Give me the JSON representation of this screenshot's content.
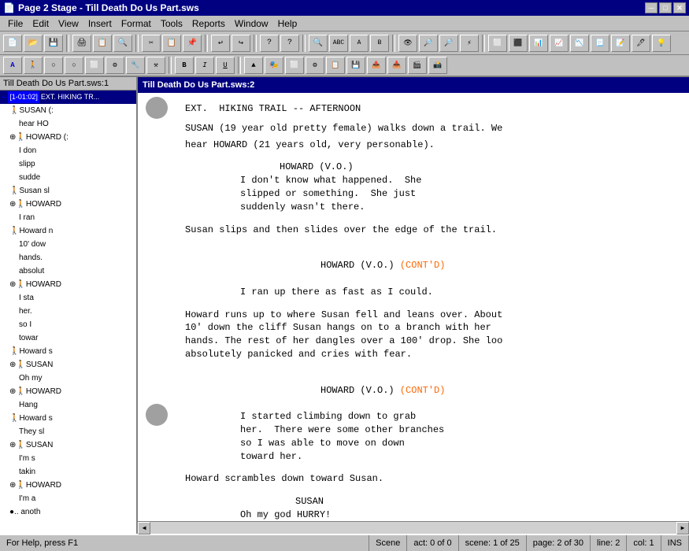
{
  "title_bar": {
    "title": "Page 2 Stage - Till Death Do Us Part.sws",
    "minimize": "─",
    "maximize": "□",
    "close": "✕"
  },
  "menu": {
    "items": [
      "File",
      "Edit",
      "View",
      "Insert",
      "Format",
      "Tools",
      "Reports",
      "Window",
      "Help"
    ]
  },
  "left_panel": {
    "header": "Till Death Do Us Part.sws:1",
    "tree_items": [
      {
        "indent": 0,
        "text": "─[1-01:02]    EXT.  HIKING TR",
        "selected": true
      },
      {
        "indent": 1,
        "text": "🚶SUSAN (:"
      },
      {
        "indent": 2,
        "text": "hear HO"
      },
      {
        "indent": 1,
        "text": "⊕🚶HOWARD (:"
      },
      {
        "indent": 2,
        "text": "I don"
      },
      {
        "indent": 2,
        "text": "slipp"
      },
      {
        "indent": 2,
        "text": "sudde"
      },
      {
        "indent": 1,
        "text": "🚶Susan sl"
      },
      {
        "indent": 1,
        "text": "⊕🚶HOWARD"
      },
      {
        "indent": 2,
        "text": "I ran"
      },
      {
        "indent": 1,
        "text": "🚶Howard r"
      },
      {
        "indent": 2,
        "text": "10' dow"
      },
      {
        "indent": 2,
        "text": "hands."
      },
      {
        "indent": 2,
        "text": "absolut"
      },
      {
        "indent": 1,
        "text": "⊕🚶HOWARD"
      },
      {
        "indent": 2,
        "text": "I sta"
      },
      {
        "indent": 2,
        "text": "her."
      },
      {
        "indent": 2,
        "text": "so I"
      },
      {
        "indent": 2,
        "text": "towar"
      },
      {
        "indent": 1,
        "text": "🚶Howard s"
      },
      {
        "indent": 1,
        "text": "⊕🚶SUSAN"
      },
      {
        "indent": 2,
        "text": "Oh my"
      },
      {
        "indent": 1,
        "text": "⊕🚶HOWARD"
      },
      {
        "indent": 2,
        "text": "Hang"
      },
      {
        "indent": 1,
        "text": "🚶Howard s"
      },
      {
        "indent": 2,
        "text": "They sl"
      },
      {
        "indent": 1,
        "text": "⊕🚶SUSAN"
      },
      {
        "indent": 2,
        "text": "I'm s"
      },
      {
        "indent": 2,
        "text": "takin"
      },
      {
        "indent": 1,
        "text": "⊕🚶HOWARD"
      },
      {
        "indent": 2,
        "text": "I'm a"
      },
      {
        "indent": 1,
        "text": "...    anoth"
      }
    ]
  },
  "right_panel": {
    "header": "Till Death Do Us Part.sws:2",
    "script": [
      {
        "type": "scene",
        "text": "EXT.  HIKING TRAIL -- AFTERNOON"
      },
      {
        "type": "blank"
      },
      {
        "type": "action",
        "text": "SUSAN (19 year old pretty female) walks down a trail. We"
      },
      {
        "type": "action",
        "text": "hear HOWARD (21 years old, very personable)."
      },
      {
        "type": "blank"
      },
      {
        "type": "character",
        "text": "HOWARD (V.O.)"
      },
      {
        "type": "dialog",
        "text": "I don't know what happened.  She"
      },
      {
        "type": "dialog",
        "text": "slipped or something.  She just"
      },
      {
        "type": "dialog",
        "text": "suddenly wasn't there."
      },
      {
        "type": "blank"
      },
      {
        "type": "action",
        "text": "Susan slips and then slides over the edge of the trail."
      },
      {
        "type": "blank"
      },
      {
        "type": "character_cont",
        "text": "HOWARD (V.O.) ",
        "cont": "(CONT'D)"
      },
      {
        "type": "dialog",
        "text": "I ran up there as fast as I could."
      },
      {
        "type": "blank"
      },
      {
        "type": "action",
        "text": "Howard runs up to where Susan fell and leans over. About"
      },
      {
        "type": "action",
        "text": "10' down the cliff Susan hangs on to a branch with her"
      },
      {
        "type": "action",
        "text": "hands. The rest of her dangles over a 100' drop. She loo"
      },
      {
        "type": "action",
        "text": "absolutely panicked and cries with fear."
      },
      {
        "type": "blank"
      },
      {
        "type": "character_cont",
        "text": "HOWARD (V.O.) ",
        "cont": "(CONT'D)"
      },
      {
        "type": "dialog",
        "text": "I started climbing down to grab"
      },
      {
        "type": "dialog",
        "text": "her.  There were some other branches"
      },
      {
        "type": "dialog",
        "text": "so I was able to move on down"
      },
      {
        "type": "dialog",
        "text": "toward her."
      },
      {
        "type": "blank"
      },
      {
        "type": "action",
        "text": "Howard scrambles down toward Susan."
      },
      {
        "type": "blank"
      },
      {
        "type": "character",
        "text": "SUSAN"
      },
      {
        "type": "dialog",
        "text": "Oh my god HURRY!"
      }
    ]
  },
  "status_bar": {
    "help_text": "For Help, press F1",
    "scene": "Scene",
    "act": "act: 0 of 0",
    "scene_num": "scene: 1 of 25",
    "page": "page: 2 of 30",
    "line": "line: 2",
    "col": "col: 1",
    "ins": "INS"
  },
  "toolbar1_buttons": [
    "new",
    "open",
    "save",
    "print",
    "cut",
    "copy",
    "paste",
    "undo",
    "redo",
    "help",
    "help2",
    "find",
    "replace",
    "insert",
    "bold",
    "italic",
    "format1",
    "format2",
    "format3",
    "format4",
    "format5",
    "format6",
    "format7",
    "format8",
    "format9",
    "format10",
    "format11",
    "format12",
    "format13",
    "format14",
    "format15",
    "format16",
    "format17"
  ],
  "toolbar2_buttons": [
    "A1",
    "A2",
    "A3",
    "A4",
    "A5",
    "A6",
    "A7",
    "A8",
    "B1",
    "B2",
    "B3",
    "B4",
    "B5",
    "B6",
    "B7",
    "B8",
    "B9",
    "B10",
    "B11",
    "B12",
    "B13",
    "B14",
    "B15",
    "B16"
  ]
}
